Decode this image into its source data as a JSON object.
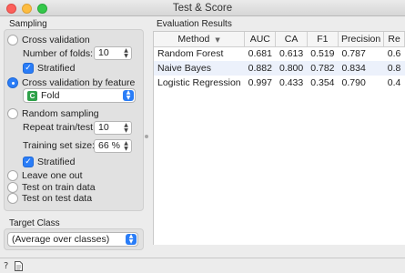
{
  "window": {
    "title": "Test & Score"
  },
  "sampling": {
    "title": "Sampling",
    "cross_validation": "Cross validation",
    "folds_label": "Number of folds:",
    "folds_value": "10",
    "stratified1": "Stratified",
    "cv_by_feature": "Cross validation by feature",
    "feature_value": "Fold",
    "feature_icon_letter": "C",
    "random_sampling": "Random sampling",
    "repeat_label": "Repeat train/test:",
    "repeat_value": "10",
    "train_size_label": "Training set size:",
    "train_size_value": "66 %",
    "stratified2": "Stratified",
    "leave_one_out": "Leave one out",
    "test_train": "Test on train data",
    "test_test": "Test on test data",
    "selected": "cv_by_feature"
  },
  "target": {
    "title": "Target Class",
    "value": "(Average over classes)"
  },
  "results": {
    "title": "Evaluation Results",
    "columns": [
      "Method",
      "AUC",
      "CA",
      "F1",
      "Precision",
      "Re"
    ],
    "rows": [
      [
        "Random Forest",
        "0.681",
        "0.613",
        "0.519",
        "0.787",
        "0.6"
      ],
      [
        "Naive Bayes",
        "0.882",
        "0.800",
        "0.782",
        "0.834",
        "0.8"
      ],
      [
        "Logistic Regression",
        "0.997",
        "0.433",
        "0.354",
        "0.790",
        "0.4"
      ]
    ]
  },
  "status": {
    "help_icon": "?",
    "report_icon": "report-icon"
  },
  "colors": {
    "accent": "#2a7df7",
    "alt_row": "#ecf1fb",
    "feature_icon": "#2fa14a"
  }
}
